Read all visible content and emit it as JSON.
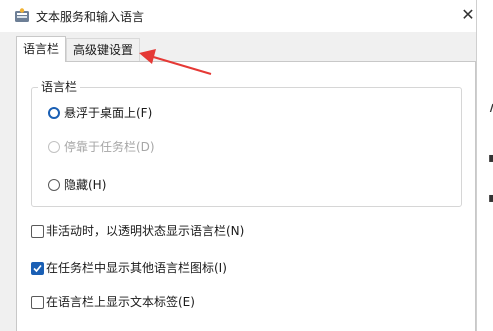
{
  "window": {
    "title": "文本服务和输入语言",
    "close_glyph": "✕"
  },
  "tabs": [
    {
      "label": "语言栏",
      "selected": true
    },
    {
      "label": "高级键设置",
      "selected": false
    }
  ],
  "group": {
    "legend": "语言栏",
    "options": [
      {
        "label": "悬浮于桌面上(F)",
        "checked": true,
        "enabled": true
      },
      {
        "label": "停靠于任务栏(D)",
        "checked": false,
        "enabled": false
      },
      {
        "label": "隐藏(H)",
        "checked": false,
        "enabled": true
      }
    ]
  },
  "checkboxes": [
    {
      "label": "非活动时，以透明状态显示语言栏(N)",
      "checked": false
    },
    {
      "label": "在任务栏中显示其他语言栏图标(I)",
      "checked": true
    },
    {
      "label": "在语言栏上显示文本标签(E)",
      "checked": false
    }
  ],
  "colors": {
    "accent": "#1a5fb4",
    "annotation_arrow": "#e53935"
  }
}
